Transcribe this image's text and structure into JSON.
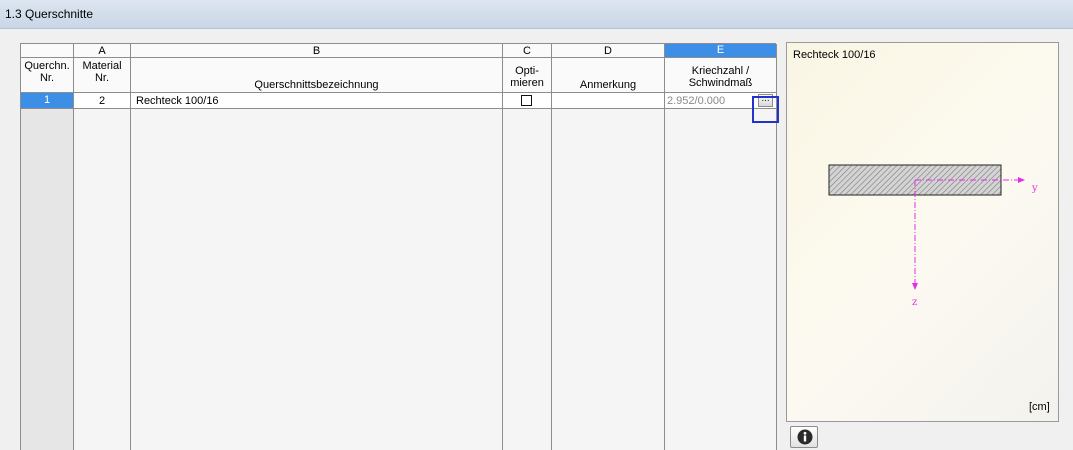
{
  "window": {
    "title": "1.3 Querschnitte"
  },
  "table": {
    "columns": [
      {
        "letter": "",
        "header": [
          "Querchn.",
          "Nr."
        ]
      },
      {
        "letter": "A",
        "header": [
          "Material",
          "Nr."
        ]
      },
      {
        "letter": "B",
        "header": [
          "",
          "Querschnittsbezeichnung"
        ]
      },
      {
        "letter": "C",
        "header": [
          "Opti-",
          "mieren"
        ]
      },
      {
        "letter": "D",
        "header": [
          "",
          "Anmerkung"
        ]
      },
      {
        "letter": "E",
        "header": [
          "Kriechzahl /",
          "Schwindmaß"
        ],
        "selected": true
      }
    ],
    "rows": [
      {
        "nr": "1",
        "material": "2",
        "name": "Rechteck 100/16",
        "optimize": false,
        "note": "",
        "creep": "2.952/0.000",
        "button": "..."
      }
    ]
  },
  "preview": {
    "title": "Rechteck 100/16",
    "units": "[cm]",
    "axis_y": "y",
    "axis_z": "z",
    "axis_color": "#e62ee6",
    "section_fill": "#c8c8c8"
  },
  "info_icon": "info-icon"
}
